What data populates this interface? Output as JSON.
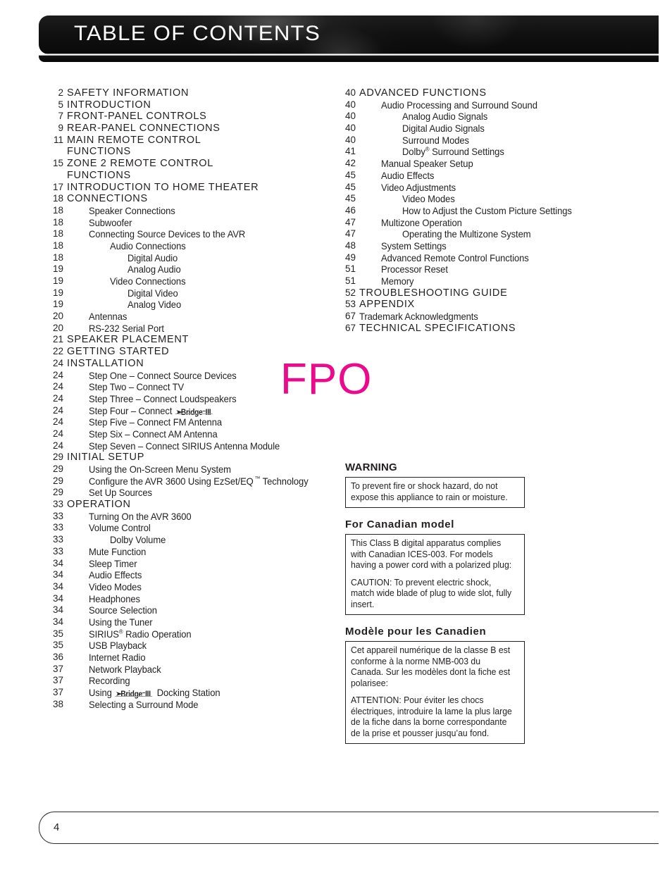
{
  "header": {
    "title": "TABLE OF CONTENTS"
  },
  "placeholder": {
    "fpo_label": "FPO",
    "fpo_color": "#ec0a8c"
  },
  "footer": {
    "page_number": "4"
  },
  "toc": {
    "left_column": [
      {
        "page": "2",
        "label": "SAFETY INFORMATION",
        "style": "major",
        "indent": 0
      },
      {
        "page": "5",
        "label": "INTRODUCTION",
        "style": "major",
        "indent": 0
      },
      {
        "page": "7",
        "label": "FRONT-PANEL CONTROLS",
        "style": "major",
        "indent": 0
      },
      {
        "page": "9",
        "label": "REAR-PANEL CONNECTIONS",
        "style": "major",
        "indent": 0
      },
      {
        "page": "11",
        "label": "MAIN REMOTE CONTROL",
        "style": "major",
        "indent": 0
      },
      {
        "page": "",
        "label": "FUNCTIONS",
        "style": "major",
        "indent": 0,
        "continuation": true
      },
      {
        "page": "15",
        "label": "ZONE 2 REMOTE CONTROL",
        "style": "major",
        "indent": 0
      },
      {
        "page": "",
        "label": "FUNCTIONS",
        "style": "major",
        "indent": 0,
        "continuation": true
      },
      {
        "page": "17",
        "label": "INTRODUCTION TO HOME THEATER",
        "style": "major",
        "indent": 0
      },
      {
        "page": "18",
        "label": "CONNECTIONS",
        "style": "major",
        "indent": 0
      },
      {
        "page": "18",
        "label": "Speaker Connections",
        "style": "minor",
        "indent": 1
      },
      {
        "page": "18",
        "label": "Subwoofer",
        "style": "minor",
        "indent": 1
      },
      {
        "page": "18",
        "label": "Connecting Source Devices to the AVR",
        "style": "minor",
        "indent": 1
      },
      {
        "page": "18",
        "label": "Audio Connections",
        "style": "minor",
        "indent": 2
      },
      {
        "page": "18",
        "label": "Digital Audio",
        "style": "minor",
        "indent": 3
      },
      {
        "page": "19",
        "label": "Analog Audio",
        "style": "minor",
        "indent": 3
      },
      {
        "page": "19",
        "label": "Video Connections",
        "style": "minor",
        "indent": 2
      },
      {
        "page": "19",
        "label": "Digital Video",
        "style": "minor",
        "indent": 3
      },
      {
        "page": "19",
        "label": "Analog Video",
        "style": "minor",
        "indent": 3
      },
      {
        "page": "20",
        "label": "Antennas",
        "style": "minor",
        "indent": 1
      },
      {
        "page": "20",
        "label": "RS-232 Serial Port",
        "style": "minor",
        "indent": 1
      },
      {
        "page": "21",
        "label": "SPEAKER PLACEMENT",
        "style": "major",
        "indent": 0
      },
      {
        "page": "22",
        "label": "GETTING STARTED",
        "style": "major",
        "indent": 0
      },
      {
        "page": "24",
        "label": "INSTALLATION",
        "style": "major",
        "indent": 0
      },
      {
        "page": "24",
        "label": "Step One – Connect Source Devices",
        "style": "minor",
        "indent": 1
      },
      {
        "page": "24",
        "label": "Step Two – Connect TV",
        "style": "minor",
        "indent": 1
      },
      {
        "page": "24",
        "label": "Step Three – Connect Loudspeakers",
        "style": "minor",
        "indent": 1
      },
      {
        "page": "24",
        "label": "Step Four – Connect ",
        "style": "minor",
        "indent": 1,
        "logo_after": "bridge-iii"
      },
      {
        "page": "24",
        "label": "Step Five – Connect FM Antenna",
        "style": "minor",
        "indent": 1
      },
      {
        "page": "24",
        "label": "Step Six – Connect AM Antenna",
        "style": "minor",
        "indent": 1
      },
      {
        "page": "24",
        "label": "Step Seven – Connect SIRIUS Antenna Module",
        "style": "minor",
        "indent": 1
      },
      {
        "page": "29",
        "label": "INITIAL SETUP",
        "style": "major",
        "indent": 0
      },
      {
        "page": "29",
        "label": "Using the On-Screen Menu System",
        "style": "minor",
        "indent": 1
      },
      {
        "page": "29",
        "label": "Configure the AVR 3600 Using EzSet/EQ",
        "style": "minor",
        "indent": 1,
        "sup_tm": "™",
        "label_tail": " Technology"
      },
      {
        "page": "29",
        "label": "Set Up Sources",
        "style": "minor",
        "indent": 1
      },
      {
        "page": "33",
        "label": "OPERATION",
        "style": "major",
        "indent": 0
      },
      {
        "page": "33",
        "label": "Turning On the AVR 3600",
        "style": "minor",
        "indent": 1
      },
      {
        "page": "33",
        "label": "Volume Control",
        "style": "minor",
        "indent": 1
      },
      {
        "page": "33",
        "label": "Dolby Volume",
        "style": "minor",
        "indent": 2
      },
      {
        "page": "33",
        "label": "Mute Function",
        "style": "minor",
        "indent": 1
      },
      {
        "page": "34",
        "label": "Sleep Timer",
        "style": "minor",
        "indent": 1
      },
      {
        "page": "34",
        "label": "Audio Effects",
        "style": "minor",
        "indent": 1
      },
      {
        "page": "34",
        "label": "Video Modes",
        "style": "minor",
        "indent": 1
      },
      {
        "page": "34",
        "label": "Headphones",
        "style": "minor",
        "indent": 1
      },
      {
        "page": "34",
        "label": "Source Selection",
        "style": "minor",
        "indent": 1
      },
      {
        "page": "34",
        "label": "Using the Tuner",
        "style": "minor",
        "indent": 1
      },
      {
        "page": "35",
        "label": "SIRIUS",
        "style": "minor",
        "indent": 1,
        "sup": "®",
        "label_tail": " Radio Operation"
      },
      {
        "page": "35",
        "label": "USB Playback",
        "style": "minor",
        "indent": 1
      },
      {
        "page": "36",
        "label": "Internet Radio",
        "style": "minor",
        "indent": 1
      },
      {
        "page": "37",
        "label": "Network Playback",
        "style": "minor",
        "indent": 1
      },
      {
        "page": "37",
        "label": "Recording",
        "style": "minor",
        "indent": 1
      },
      {
        "page": "37",
        "label": "Using ",
        "style": "minor",
        "indent": 1,
        "logo_after": "bridge-iii",
        "label_tail2": " Docking Station"
      },
      {
        "page": "38",
        "label": "Selecting a Surround Mode",
        "style": "minor",
        "indent": 1
      }
    ],
    "right_column": [
      {
        "page": "40",
        "label": "ADVANCED FUNCTIONS",
        "style": "major",
        "indent": 0
      },
      {
        "page": "40",
        "label": "Audio Processing and Surround Sound",
        "style": "minor",
        "indent": 1
      },
      {
        "page": "40",
        "label": "Analog Audio Signals",
        "style": "minor",
        "indent": 2
      },
      {
        "page": "40",
        "label": "Digital Audio Signals",
        "style": "minor",
        "indent": 2
      },
      {
        "page": "40",
        "label": "Surround Modes",
        "style": "minor",
        "indent": 2
      },
      {
        "page": "41",
        "label": "Dolby",
        "style": "minor",
        "indent": 2,
        "sup": "®",
        "label_tail": " Surround Settings"
      },
      {
        "page": "42",
        "label": "Manual Speaker Setup",
        "style": "minor",
        "indent": 1
      },
      {
        "page": "45",
        "label": "Audio Effects",
        "style": "minor",
        "indent": 1
      },
      {
        "page": "45",
        "label": "Video Adjustments",
        "style": "minor",
        "indent": 1
      },
      {
        "page": "45",
        "label": "Video Modes",
        "style": "minor",
        "indent": 2
      },
      {
        "page": "46",
        "label": "How to Adjust the Custom Picture Settings",
        "style": "minor",
        "indent": 2
      },
      {
        "page": "47",
        "label": "Multizone Operation",
        "style": "minor",
        "indent": 1
      },
      {
        "page": "47",
        "label": "Operating the Multizone System",
        "style": "minor",
        "indent": 2
      },
      {
        "page": "48",
        "label": "System Settings",
        "style": "minor",
        "indent": 1
      },
      {
        "page": "49",
        "label": "Advanced Remote Control Functions",
        "style": "minor",
        "indent": 1
      },
      {
        "page": "51",
        "label": "Processor Reset",
        "style": "minor",
        "indent": 1
      },
      {
        "page": "51",
        "label": "Memory",
        "style": "minor",
        "indent": 1
      },
      {
        "page": "52",
        "label": "TROUBLESHOOTING GUIDE",
        "style": "major",
        "indent": 0
      },
      {
        "page": "53",
        "label": "APPENDIX",
        "style": "major",
        "indent": 0
      },
      {
        "page": "67",
        "label": "Trademark Acknowledgments",
        "style": "minor",
        "indent": 0
      },
      {
        "page": "67",
        "label": "TECHNICAL SPECIFICATIONS",
        "style": "major",
        "indent": 0
      }
    ]
  },
  "notices": [
    {
      "heading": "WARNING",
      "heading_style": "plain",
      "paragraphs": [
        "To prevent fire or shock hazard, do not expose this appliance to rain or moisture."
      ]
    },
    {
      "heading": "For Canadian model",
      "heading_style": "spaced",
      "paragraphs": [
        "This Class B digital apparatus complies with Canadian ICES-003. For models having a power cord with a polarized plug:",
        "CAUTION: To prevent electric shock, match wide blade of plug to wide slot, fully insert."
      ]
    },
    {
      "heading": "Modèle pour les Canadien",
      "heading_style": "spaced",
      "paragraphs": [
        "Cet appareil numérique de la classe B est conforme à la norme NMB-003 du Canada. Sur les modèles dont la fiche est polarisee:",
        "ATTENTION: Pour éviter les chocs électriques, introduire la lame la plus large de la fiche dans la borne correspondante de la prise et pousser jusqu’au fond."
      ]
    }
  ],
  "logos": {
    "bridge_iii": {
      "arrow": "➤",
      "word": "Bridge",
      "separator": "–",
      "numeral": "III"
    }
  }
}
